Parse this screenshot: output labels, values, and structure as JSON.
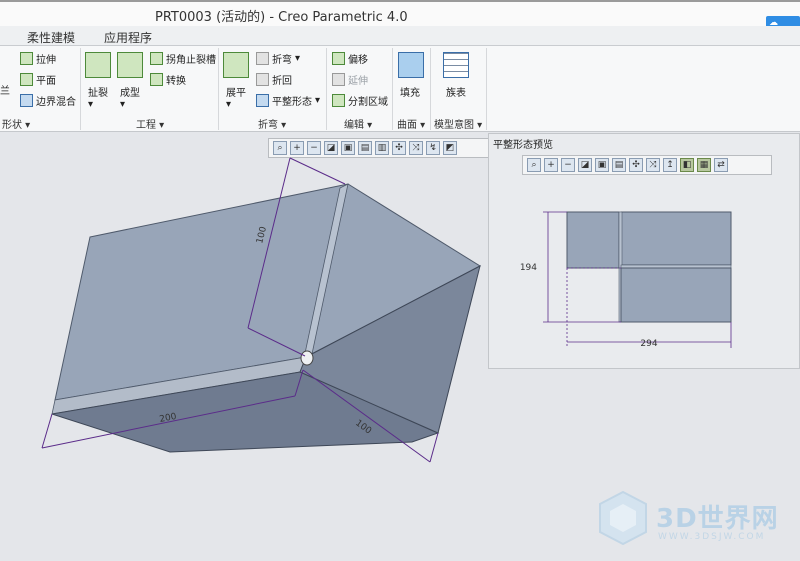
{
  "window": {
    "title": "PRT0003 (活动的) - Creo Parametric 4.0",
    "help_icon": "?"
  },
  "tabs": [
    "柔性建模",
    "应用程序"
  ],
  "ribbon": {
    "shape_group": {
      "label": "形状",
      "items": [
        "兰",
        "拉伸",
        "平面",
        "边界混合"
      ]
    },
    "eng_group": {
      "label": "工程",
      "big": [
        "扯裂",
        "成型"
      ],
      "items": [
        "拐角止裂槽",
        "转换"
      ]
    },
    "bend_group": {
      "label": "折弯",
      "big": [
        "展平"
      ],
      "items": [
        "折弯",
        "折回",
        "平整形态"
      ]
    },
    "edit_group": {
      "label": "编辑",
      "items": [
        "偏移",
        "延伸",
        "分割区域"
      ]
    },
    "surface_group": {
      "label": "曲面",
      "big": [
        "填充"
      ]
    },
    "model_group": {
      "label": "模型意图",
      "big": [
        "族表"
      ]
    }
  },
  "model_dims": {
    "height": "100",
    "width": "200",
    "depth": "100"
  },
  "preview": {
    "title": "平整形态预览",
    "dim_height": "194",
    "dim_width": "294"
  },
  "watermark": {
    "text": "3D世界网",
    "url": "WWW.3DSJW.COM"
  },
  "colors": {
    "part_top": "#98a5b8",
    "part_side": "#6f7b90",
    "dim_line": "#5b2c8a",
    "accent": "#2f8de4"
  }
}
